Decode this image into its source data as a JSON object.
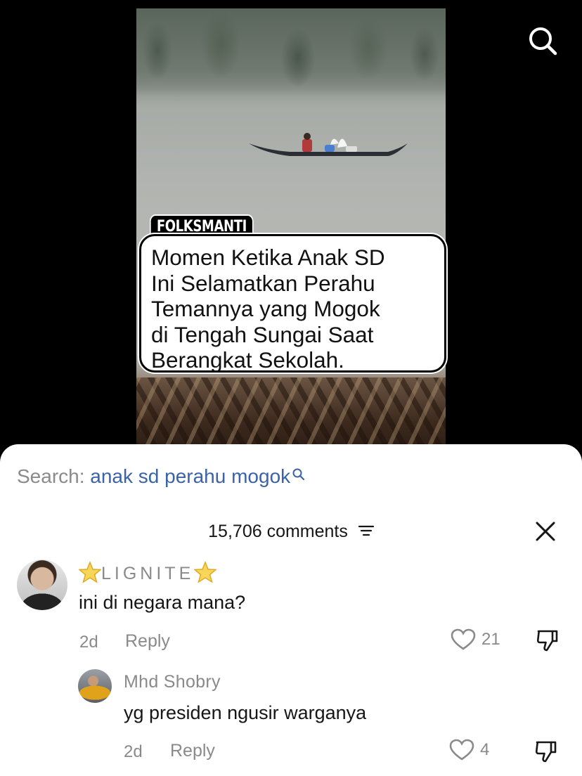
{
  "video": {
    "channel_tag": "FOLKSMANTI",
    "caption_lines": [
      "Momen Ketika Anak SD",
      "Ini Selamatkan Perahu",
      "Temannya yang Mogok",
      "di Tengah Sungai Saat",
      "Berangkat Sekolah."
    ]
  },
  "top_bar": {
    "search_icon": "search-icon"
  },
  "sheet": {
    "search_prefix": "Search: ",
    "search_query": "anak sd perahu mogok",
    "comments_count": "15,706 comments",
    "filter_icon": "filter-icon",
    "close_icon": "close-icon"
  },
  "comments": [
    {
      "username": "LIGNITE",
      "username_decoration": "star-emoji",
      "text": "ini di negara mana?",
      "time": "2d",
      "reply_label": "Reply",
      "likes": "21"
    },
    {
      "username": "Mhd Shobry",
      "text": "yg presiden ngusir warganya",
      "time": "2d",
      "reply_label": "Reply",
      "likes": "4"
    }
  ],
  "colors": {
    "accent_query": "#3a63a8",
    "muted_text": "#8a8a8a",
    "primary_text": "#161616"
  }
}
